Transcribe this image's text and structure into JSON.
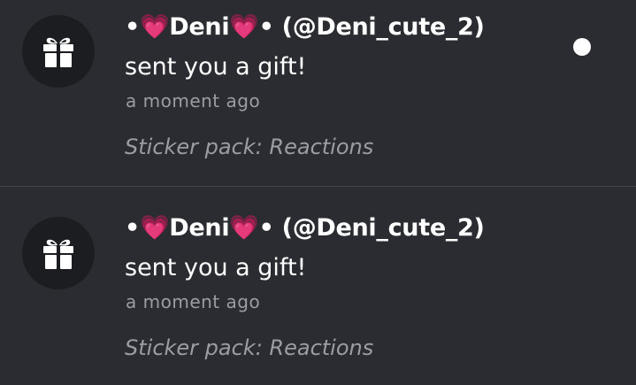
{
  "notifications": [
    {
      "sender": "•💗Deni💗• (@Deni_cute_2)",
      "message": "sent you a gift!",
      "time": "a moment ago",
      "detail": "Sticker pack: Reactions",
      "icon": "gift-icon",
      "unread": true
    },
    {
      "sender": "•💗Deni💗• (@Deni_cute_2)",
      "message": "sent you a gift!",
      "time": "a moment ago",
      "detail": "Sticker pack: Reactions",
      "icon": "gift-icon",
      "unread": false
    }
  ],
  "colors": {
    "background": "#2b2c31",
    "avatar_background": "#1c1d20",
    "primary_text": "#ffffff",
    "secondary_text": "#9c9ca3",
    "divider": "#45464c",
    "unread_dot": "#ffffff"
  }
}
